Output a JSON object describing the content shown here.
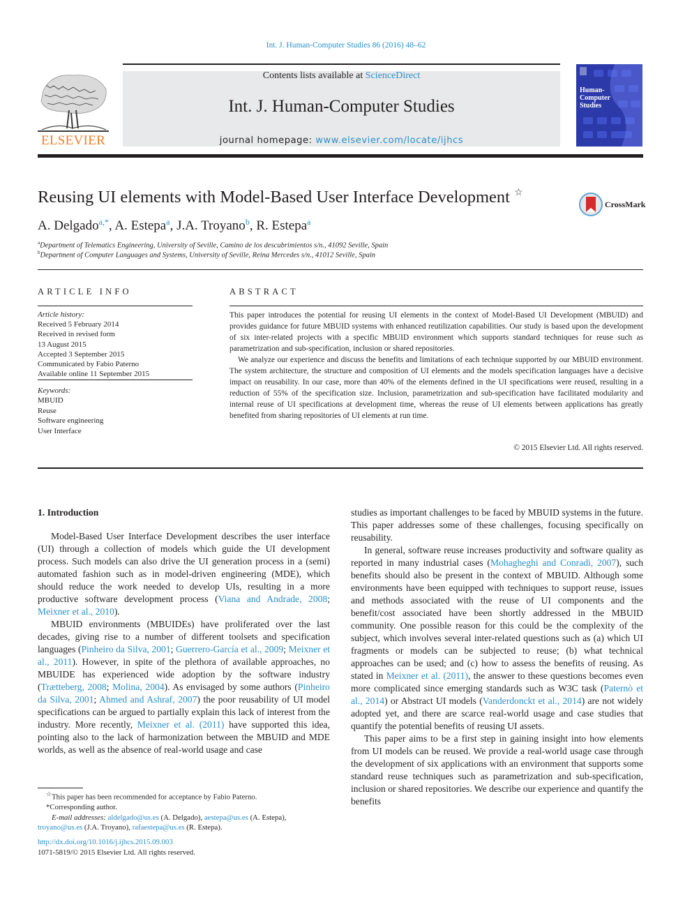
{
  "citation": "Int. J. Human-Computer Studies 86 (2016) 48–62",
  "header": {
    "contents_prefix": "Contents lists available at ",
    "contents_link": "ScienceDirect",
    "journal_title": "Int. J. Human-Computer Studies",
    "homepage_prefix": "journal homepage: ",
    "homepage_link": "www.elsevier.com/locate/ijhcs",
    "publisher_logo_text": "ELSEVIER",
    "cover_title": "Human-\nComputer\nStudies",
    "colors": {
      "link": "#2a8fc9",
      "masthead_bg": "#e8e9ea",
      "elsevier_orange": "#f07e26",
      "cover_blue": "#2b3aa8"
    }
  },
  "title": {
    "text": "Reusing UI elements with Model-Based User Interface Development",
    "star": "☆",
    "crossmark_label": "CrossMark"
  },
  "authors": [
    {
      "name": "A. Delgado",
      "sup": "a,*"
    },
    {
      "name": "A. Estepa",
      "sup": "a"
    },
    {
      "name": "J.A. Troyano",
      "sup": "b"
    },
    {
      "name": "R. Estepa",
      "sup": "a"
    }
  ],
  "affiliations": [
    {
      "sup": "a",
      "text": "Department of Telematics Engineering, University of Seville, Camino de los descubrimientos s/n., 41092 Seville, Spain"
    },
    {
      "sup": "b",
      "text": "Department of Computer Languages and Systems, University of Seville, Reina Mercedes s/n., 41012 Seville, Spain"
    }
  ],
  "article_info": {
    "heading": "ARTICLE INFO",
    "history_label": "Article history:",
    "history": [
      "Received 5 February 2014",
      "Received in revised form",
      "13 August 2015",
      "Accepted 3 September 2015",
      "Communicated by Fabio Paterno",
      "Available online 11 September 2015"
    ],
    "keywords_label": "Keywords:",
    "keywords": [
      "MBUID",
      "Reuse",
      "Software engineering",
      "User Interface"
    ]
  },
  "abstract": {
    "heading": "ABSTRACT",
    "paragraphs": [
      "This paper introduces the potential for reusing UI elements in the context of Model-Based UI Development (MBUID) and provides guidance for future MBUID systems with enhanced reutilization capabilities. Our study is based upon the development of six inter-related projects with a specific MBUID environment which supports standard techniques for reuse such as parametrization and sub-specification, inclusion or shared repositories.",
      "We analyze our experience and discuss the benefits and limitations of each technique supported by our MBUID environment. The system architecture, the structure and composition of UI elements and the models specification languages have a decisive impact on reusability. In our case, more than 40% of the elements defined in the UI specifications were reused, resulting in a reduction of 55% of the specification size. Inclusion, parametrization and sub-specification have facilitated modularity and internal reuse of UI specifications at development time, whereas the reuse of UI elements between applications has greatly benefited from sharing repositories of UI elements at run time."
    ],
    "copyright": "© 2015 Elsevier Ltd. All rights reserved."
  },
  "intro": {
    "heading": "1.  Introduction",
    "p1": [
      {
        "t": "Model-Based User Interface Development describes the user interface (UI) through a collection of models which guide the UI development process. Such models can also drive the UI generation process in a (semi) automated fashion such as in model-driven engineering (MDE), which should reduce the work needed to develop UIs, resulting in a more productive software development process ("
      },
      {
        "t": "Viana and Andrade, 2008",
        "link": true
      },
      {
        "t": "; "
      },
      {
        "t": "Meixner et al., 2010",
        "link": true
      },
      {
        "t": ")."
      }
    ],
    "p2": [
      {
        "t": "MBUID environments (MBUIDEs) have proliferated over the last decades, giving rise to a number of different toolsets and specification languages ("
      },
      {
        "t": "Pinheiro da Silva, 2001",
        "link": true
      },
      {
        "t": "; "
      },
      {
        "t": "Guerrero-García et al., 2009",
        "link": true
      },
      {
        "t": "; "
      },
      {
        "t": "Meixner et al., 2011",
        "link": true
      },
      {
        "t": "). However, in spite of the plethora of available approaches, no MBUIDE has experienced wide adoption by the software industry ("
      },
      {
        "t": "Trætteberg, 2008",
        "link": true
      },
      {
        "t": "; "
      },
      {
        "t": "Molina, 2004",
        "link": true
      },
      {
        "t": "). As envisaged by some authors ("
      },
      {
        "t": "Pinheiro da Silva, 2001",
        "link": true
      },
      {
        "t": "; "
      },
      {
        "t": "Ahmed and Ashraf, 2007",
        "link": true
      },
      {
        "t": ") the poor reusability of UI model specifications can be argued to partially explain this lack of interest from the industry. More recently, "
      },
      {
        "t": "Meixner et al. (2011)",
        "link": true
      },
      {
        "t": " have supported this idea, pointing also to the lack of harmonization between the MBUID and MDE worlds, as well as the absence of real-world usage and case"
      }
    ],
    "p2_cont": [
      {
        "t": "studies as important challenges to be faced by MBUID systems in the future. This paper addresses some of these challenges, focusing specifically on reusability."
      }
    ],
    "p3": [
      {
        "t": "In general, software reuse increases productivity and software quality as reported in many industrial cases ("
      },
      {
        "t": "Mohagheghi and Conradi, 2007",
        "link": true
      },
      {
        "t": "), such benefits should also be present in the context of MBUID. Although some environments have been equipped with techniques to support reuse, issues and methods associated with the reuse of UI components and the benefit/cost associated have been shortly addressed in the MBUID community. One possible reason for this could be the complexity of the subject, which involves several inter-related questions such as (a) which UI fragments or models can be subjected to reuse; (b) what technical approaches can be used; and (c) how to assess the benefits of reusing. As stated in "
      },
      {
        "t": "Meixner et al. (2011)",
        "link": true
      },
      {
        "t": ", the answer to these questions becomes even more complicated since emerging standards such as W3C task ("
      },
      {
        "t": "Paternò et al., 2014",
        "link": true
      },
      {
        "t": ") or Abstract UI models ("
      },
      {
        "t": "Vanderdonckt et al., 2014",
        "link": true
      },
      {
        "t": ") are not widely adopted yet, and there are scarce real-world usage and case studies that quantify the potential benefits of reusing UI assets."
      }
    ],
    "p4": [
      {
        "t": "This paper aims to be a first step in gaining insight into how elements from UI models can be reused. We provide a real-world usage case through the development of six applications with an environment that supports some standard reuse techniques such as parametrization and sub-specification, inclusion or shared repositories. We describe our experience and quantify the benefits"
      }
    ]
  },
  "footnotes": {
    "star_note": "This paper has been recommended for acceptance by Fabio Paterno.",
    "corresponding": "Corresponding author.",
    "email_label": "E-mail addresses: ",
    "emails": [
      {
        "email": "aldelgado@us.es",
        "who": " (A. Delgado), "
      },
      {
        "email": "aestepa@us.es",
        "who": " (A. Estepa), "
      },
      {
        "email": "troyano@us.es",
        "who": " (J.A. Troyano), "
      },
      {
        "email": "rafaestepa@us.es",
        "who": " (R. Estepa)."
      }
    ],
    "doi": "http://dx.doi.org/10.1016/j.ijhcs.2015.09.003",
    "issn": "1071-5819/© 2015 Elsevier Ltd. All rights reserved."
  }
}
